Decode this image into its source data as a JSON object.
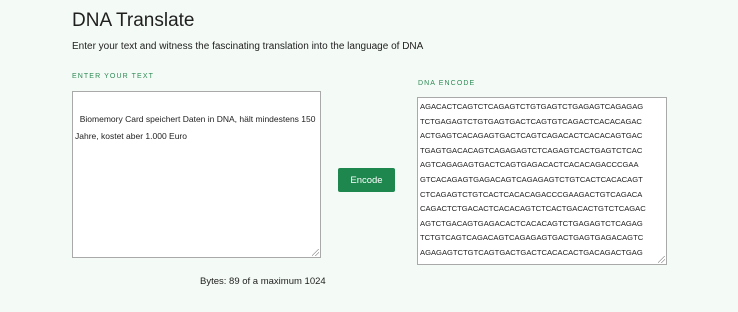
{
  "page": {
    "title": "DNA Translate",
    "subtitle": "Enter your text and witness the fascinating translation into the language of DNA"
  },
  "input": {
    "label": "ENTER YOUR TEXT",
    "value": "Biomemory Card speichert Daten in DNA, hält mindestens 150 Jahre, kostet aber 1.000 Euro"
  },
  "encode_button": {
    "label": "Encode"
  },
  "output": {
    "label": "DNA ENCODE",
    "lines": [
      "AGACACTCAGTCTCAGAGTCTGTGAGTCTGAGAGTCAGAGAG",
      "TCTGAGAGTCTGTGAGTGACTCAGTGTCAGACTCACACAGAC",
      "ACTGAGTCACAGAGTGACTCAGTCAGACACTCACACAGTGAC",
      "TGAGTGACACAGTCAGAGAGTCTCAGAGTCACTGAGTCTCAC",
      "AGTCAGAGAGTGACTCAGTGAGACACTCACACAGACCCGAA",
      "GTCACAGAGTGAGACAGTCAGAGAGTCTGTCACTCACACAGT",
      "CTCAGAGTCTGTCACTCACACAGACCCGAAGACTGTCAGACA",
      "CAGACTCTGACACTCACACAGTCTCACTGACACTGTCTCAGAC",
      "AGTCTGACAGTGAGACACTCACACAGTCTGAGAGTCTCAGAG",
      "TCTGTCAGTCAGACAGTCAGAGAGTGACTGAGTGAGACAGTC",
      "AGAGAGTCTGTCAGTGACTGACTCACACACTGACAGACTGAG"
    ]
  },
  "bytes": {
    "text": "Bytes: 89 of a maximum 1024"
  }
}
